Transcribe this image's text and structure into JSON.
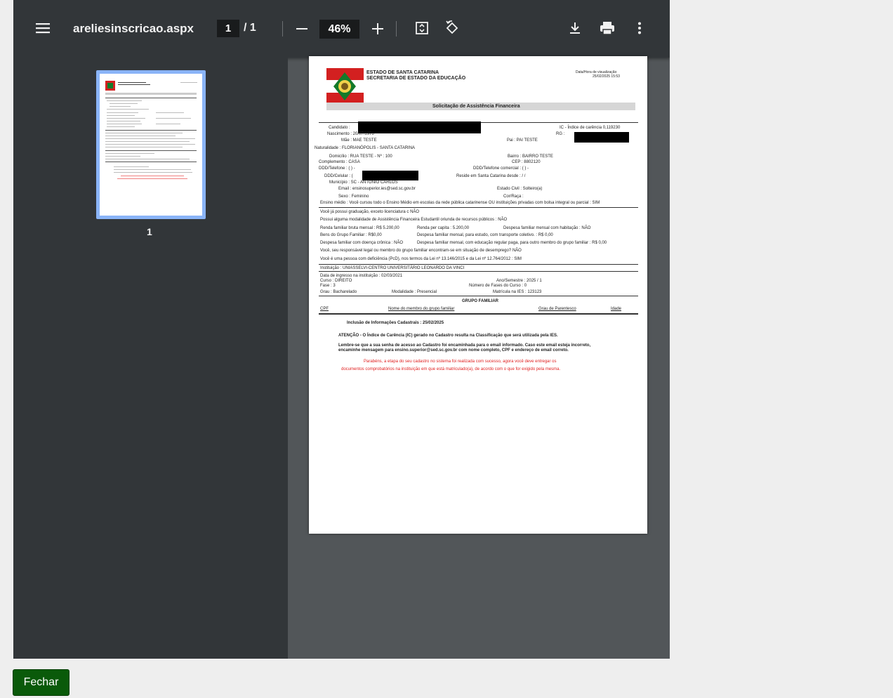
{
  "toolbar": {
    "filename": "areliesinscricao.aspx",
    "current_page": "1",
    "page_total": "/ 1",
    "zoom": "46%"
  },
  "sidebar": {
    "thumbnail_number": "1"
  },
  "doc": {
    "org1": "ESTADO DE SANTA CATARINA",
    "org2": "SECRETARIA DE ESTADO DA EDUCAÇÃO",
    "datetime_label": "Data/Hora de visualização",
    "datetime_value": "25/02/2025 15:53",
    "section_title": "Solicitação de Assistência Financeira",
    "candidato": "Candidato :",
    "ic": "IC - Índice de carência  0,119230",
    "nascimento": "Nascimento :   20/07/1976",
    "rg": "RG :",
    "mae": "Mãe :   MAE TESTE",
    "pai": "Pai :   PAI TESTE",
    "naturalidade": "Naturalidade :   FLORIANÓPOLIS - SANTA CATARINA",
    "domicilio": "Domicílio :   RUA TESTE - Nº : 100",
    "bairro": "Bairro :   BAIRRO TESTE",
    "complemento": "Complemento :   CASA",
    "cep": "CEP :   8802120",
    "telefone": "DDD/Telefone :   (     )     -",
    "telefone_com": "DDD/Telefone comercial :    (     )     -",
    "celular": "DDD/Celular :   (",
    "reside": "Reside em Santa Catarina desde :   / /",
    "municipio": "Município :   SC   -   ANTONIO CARLOS",
    "email": "Email :   ensinosuperior.ies@sed.sc.gov.br",
    "estado_civil": "Estado Civil :   Solteiro(a)",
    "sexo": "Sexo :   Feminino",
    "cor": "Cor/Raça :",
    "ensino_medio": "Ensino médio :   Você cursou todo o Ensino Médio em escolas da rede pública catarinense OU instituições privadas com bolsa integral ou parcial :  SIM",
    "graduacao": "Você já possui graduação, exceto licenciatura c  NÃO",
    "modalidade_assist": "Possui alguma modalidade de Assistência Financeira Estudantil oriunda de recursos públicos :   NÃO",
    "renda": "Renda familiar bruta mensal :   R$ 5.200,00",
    "renda_capita": "Renda per capita :   5.200,00",
    "desp_habitacao": "Despesa familiar mensal com habitação :   NÃO",
    "bens": "Bens do Grupo Familiar :       R$0,00",
    "desp_transporte": "Despesa familiar mensal, para estudo, com transporte coletivo. :   R$ 0,00",
    "doenca": "Despesa familiar com doença crônica :  NÃO",
    "desp_educacao": "Despesa familiar mensal, com educação regular paga, para outro membro do grupo familiar :  R$ 0,00",
    "desemprego": "Você, seu responsável legal ou membro do grupo familiar encontram-se em situação de desemprego?   NÃO",
    "pcd": "Você é uma pessoa com deficiência (PcD), nos termos da Lei nº 13.146/2015 e da Lei nº 12.764/2012 :   SIM",
    "instituicao": "Instituição :    UNIASSELVI-CENTRO UNIVERSITÁRIO LEONARDO DA VINCI",
    "ingresso": "Data de ingresso na instituição :    02/03/2021",
    "curso": "Curso :   DIREITO",
    "ano": "Ano/Semestre :   2025  /  1",
    "fase": "Fase :   3",
    "num_fases": "Número de Fases do Curso :   0",
    "grau": "Grau :   Bacharelado",
    "modalidade": "Modalidade :   Presencial",
    "matricula": "Matrícula na IES :   123123",
    "grupo_title": "GRUPO FAMILIAR",
    "col_cpf": "CPF",
    "col_nome": "Nome do membro do grupo familiar",
    "col_grau": "Grau de Parentesco",
    "col_idade": "Idade",
    "inclusao": "Inclusão de Informações Cadastrais :   25/02/2025",
    "atencao": "ATENÇÃO - O Índice de Carência (IC) gerado no Cadastro resulta na Classificação que será utilizada pela IES.",
    "lembre1": "Lembre-se que a sua senha de acesso ao Cadastro foi encaminhada para o email informado. Caso este email esteja incorreto,",
    "lembre2": "encaminhe mensagem para ensino.superior@sed.sc.gov.br com nome completo, CPF e endereço de email correto.",
    "parabens1": "Parabéns, a etapa do seu cadastro  no sistema  foi realizada com sucesso, agora você deve entregar os",
    "parabens2": "documentos comprobatórios na instituição em que está matriculado(a), de acordo com o que for exigido pela mesma."
  },
  "footer": {
    "close_label": "Fechar"
  },
  "colors": {
    "toolbar": "#323639",
    "viewer_bg": "#525659",
    "close_button": "#0a5a0a",
    "notice_red": "#e02020",
    "thumb_highlight": "#8ab4f8"
  }
}
